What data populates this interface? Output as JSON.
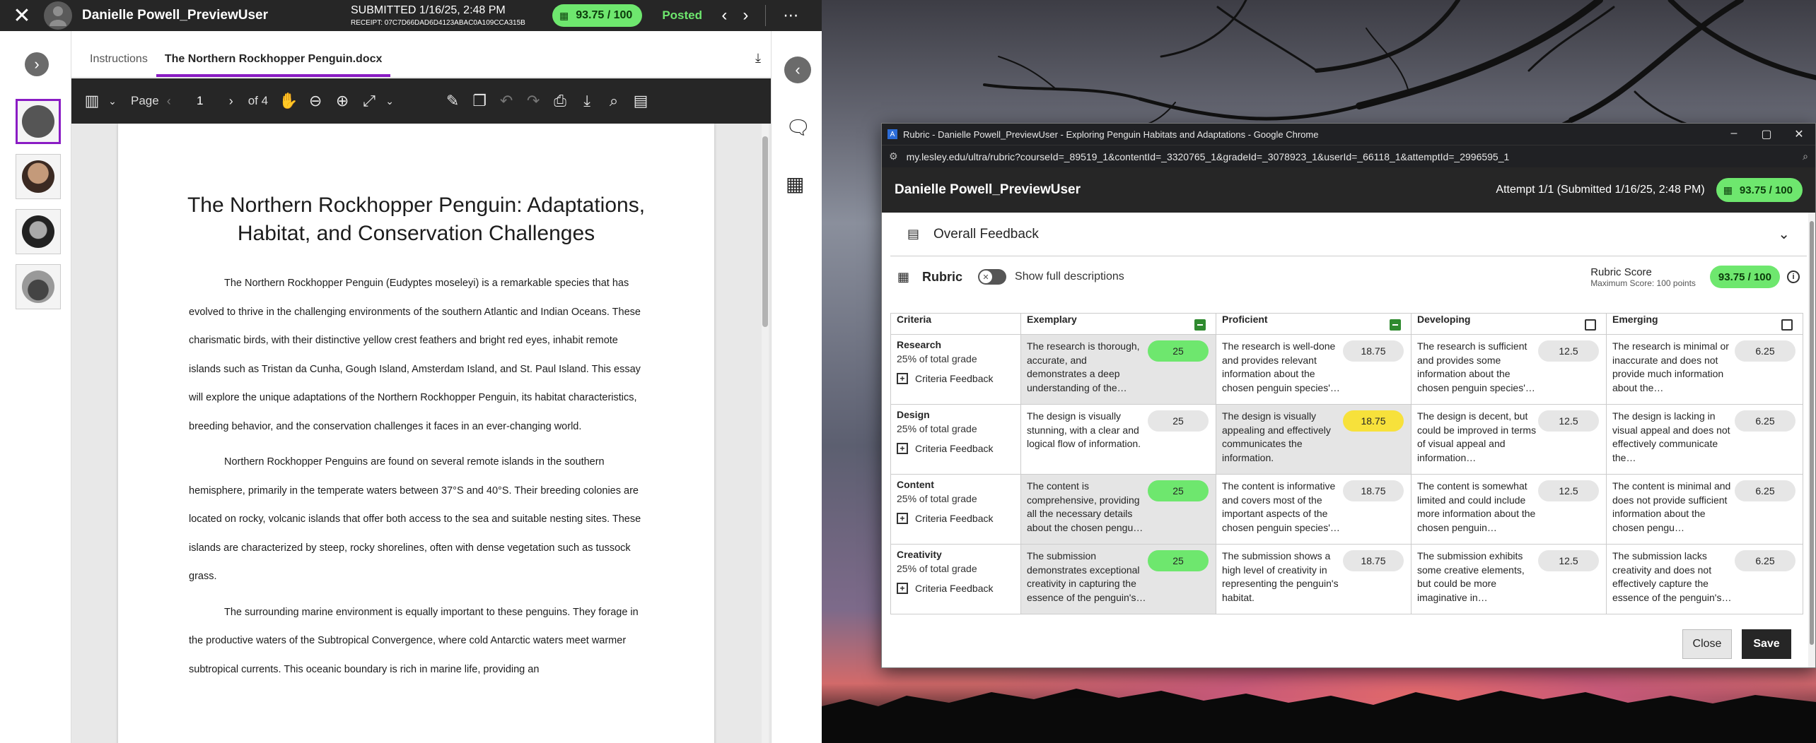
{
  "topbar": {
    "student_name": "Danielle Powell_PreviewUser",
    "submitted": "SUBMITTED 1/16/25, 2:48 PM",
    "receipt": "RECEIPT: 07C7D66DAD6D4123ABAC0A109CCA315B",
    "grade": "93.75 / 100",
    "status": "Posted"
  },
  "doc": {
    "tabs": [
      "Instructions",
      "The Northern Rockhopper Penguin.docx"
    ],
    "page_label": "Page",
    "page_number": "1",
    "page_of": "of 4",
    "title": "The Northern Rockhopper Penguin: Adaptations, Habitat, and Conservation Challenges",
    "paragraphs": [
      "The Northern Rockhopper Penguin (Eudyptes moseleyi) is a remarkable species that has evolved to thrive in the challenging environments of the southern Atlantic and Indian Oceans. These charismatic birds, with their distinctive yellow crest feathers and bright red eyes, inhabit remote islands such as Tristan da Cunha, Gough Island, Amsterdam Island, and St. Paul Island. This essay will explore the unique adaptations of the Northern Rockhopper Penguin, its habitat characteristics, breeding behavior, and the conservation challenges it faces in an ever-changing world.",
      "Northern Rockhopper Penguins are found on several remote islands in the southern hemisphere, primarily in the temperate waters between 37°S and 40°S. Their breeding colonies are located on rocky, volcanic islands that offer both access to the sea and suitable nesting sites. These islands are characterized by steep, rocky shorelines, often with dense vegetation such as tussock grass.",
      "The surrounding marine environment is equally important to these penguins. They forage in the productive waters of the Subtropical Convergence, where cold Antarctic waters meet warmer subtropical currents. This oceanic boundary is rich in marine life, providing an"
    ]
  },
  "window": {
    "title": "Rubric - Danielle Powell_PreviewUser - Exploring Penguin Habitats and Adaptations - Google Chrome",
    "url": "my.lesley.edu/ultra/rubric?courseId=_89519_1&contentId=_3320765_1&gradeId=_3078923_1&userId=_66118_1&attemptId=_2996595_1"
  },
  "rubric_panel": {
    "student_name": "Danielle Powell_PreviewUser",
    "attempt": "Attempt 1/1 (Submitted 1/16/25, 2:48 PM)",
    "grade": "93.75 / 100",
    "overall_feedback": "Overall Feedback",
    "rubric_label": "Rubric",
    "show_full": "Show full descriptions",
    "rubric_score_label": "Rubric Score",
    "max_score": "Maximum Score: 100 points",
    "rubric_score": "93.75 / 100",
    "close_label": "Close",
    "save_label": "Save"
  },
  "rubric": {
    "headers": [
      "Criteria",
      "Exemplary",
      "Proficient",
      "Developing",
      "Emerging"
    ],
    "criteria_feedback_label": "Criteria Feedback",
    "rows": [
      {
        "name": "Research",
        "weight": "25% of total grade",
        "cells": [
          {
            "desc": "The research is thorough, accurate, and demonstrates a deep understanding of the…",
            "pts": "25"
          },
          {
            "desc": "The research is well-done and provides relevant information about the chosen penguin species'…",
            "pts": "18.75"
          },
          {
            "desc": "The research is sufficient and provides some information about the chosen penguin species'…",
            "pts": "12.5"
          },
          {
            "desc": "The research is minimal or inaccurate and does not provide much information about the…",
            "pts": "6.25"
          }
        ]
      },
      {
        "name": "Design",
        "weight": "25% of total grade",
        "cells": [
          {
            "desc": "The design is visually stunning, with a clear and logical flow of information.",
            "pts": "25"
          },
          {
            "desc": "The design is visually appealing and effectively communicates the information.",
            "pts": "18.75"
          },
          {
            "desc": "The design is decent, but could be improved in terms of visual appeal and information…",
            "pts": "12.5"
          },
          {
            "desc": "The design is lacking in visual appeal and does not effectively communicate the…",
            "pts": "6.25"
          }
        ]
      },
      {
        "name": "Content",
        "weight": "25% of total grade",
        "cells": [
          {
            "desc": "The content is comprehensive, providing all the necessary details about the chosen pengu…",
            "pts": "25"
          },
          {
            "desc": "The content is informative and covers most of the important aspects of the chosen penguin species'…",
            "pts": "18.75"
          },
          {
            "desc": "The content is somewhat limited and could include more information about the chosen penguin…",
            "pts": "12.5"
          },
          {
            "desc": "The content is minimal and does not provide sufficient information about the chosen pengu…",
            "pts": "6.25"
          }
        ]
      },
      {
        "name": "Creativity",
        "weight": "25% of total grade",
        "cells": [
          {
            "desc": "The submission demonstrates exceptional creativity in capturing the essence of the penguin's…",
            "pts": "25"
          },
          {
            "desc": "The submission shows a high level of creativity in representing the penguin's habitat.",
            "pts": "18.75"
          },
          {
            "desc": "The submission exhibits some creative elements, but could be more imaginative in…",
            "pts": "12.5"
          },
          {
            "desc": "The submission lacks creativity and does not effectively capture the essence of the penguin's…",
            "pts": "6.25"
          }
        ]
      }
    ]
  },
  "colors": {
    "accent": "#8a1cc4",
    "grade_green": "#6ee76e",
    "selected_yellow": "#f7e13b",
    "dark_bar": "#262626"
  }
}
